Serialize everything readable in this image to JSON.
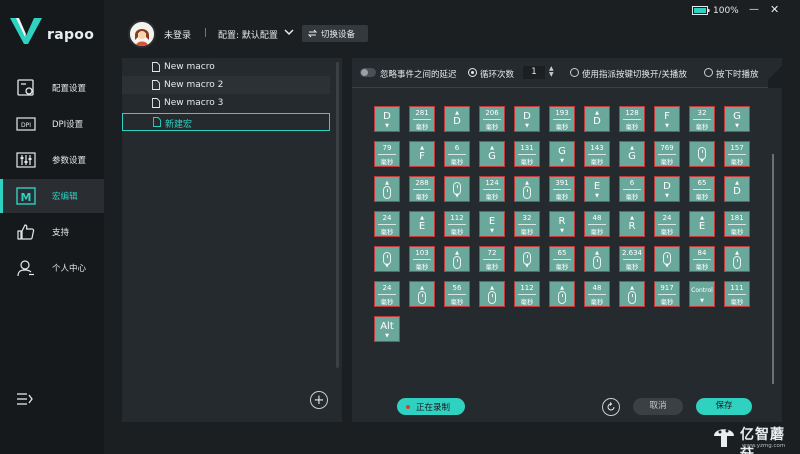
{
  "brand": {
    "name": "rapoo",
    "accent": "#2fd1c1"
  },
  "sidebar": {
    "items": [
      {
        "label": "配置设置",
        "icon": "config-icon"
      },
      {
        "label": "DPI设置",
        "icon": "dpi-icon"
      },
      {
        "label": "参数设置",
        "icon": "sliders-icon"
      },
      {
        "label": "宏编辑",
        "icon": "macro-icon",
        "active": true
      },
      {
        "label": "支持",
        "icon": "thumbs-up-icon"
      },
      {
        "label": "个人中心",
        "icon": "user-icon"
      }
    ],
    "dpi_icon_text": "DPI",
    "macro_icon_text": "M"
  },
  "topbar": {
    "login": "未登录",
    "separator": "|",
    "config": "配置: 默认配置",
    "switch_device": "切换设备",
    "battery": "100%",
    "minimize": "—",
    "close": "✕"
  },
  "macros": {
    "items": [
      "New macro",
      "New macro 2",
      "New macro 3",
      "新建宏"
    ],
    "selected_index": 3,
    "add_label": "+"
  },
  "editor": {
    "ignore_delay_label": "忽略事件之间的延迟",
    "loop_label": "循环次数",
    "loop_count": "1",
    "toggle_mode_label": "使用指派按键切换开/关播放",
    "hold_mode_label": "按下时播放",
    "stepper_up": "▲",
    "stepper_down": "▼",
    "delay_unit": "毫秒",
    "arrow_up": "▲",
    "arrow_down": "▼",
    "record_label": "正在录制",
    "cancel_label": "取消",
    "save_label": "保存",
    "events": [
      {
        "t": "key",
        "label": "D",
        "dir": "down"
      },
      {
        "t": "delay",
        "v": "281"
      },
      {
        "t": "key",
        "label": "D",
        "dir": "up"
      },
      {
        "t": "delay",
        "v": "206"
      },
      {
        "t": "key",
        "label": "D",
        "dir": "down"
      },
      {
        "t": "delay",
        "v": "193"
      },
      {
        "t": "key",
        "label": "D",
        "dir": "up"
      },
      {
        "t": "delay",
        "v": "128"
      },
      {
        "t": "key",
        "label": "F",
        "dir": "down"
      },
      {
        "t": "delay",
        "v": "32"
      },
      {
        "t": "key",
        "label": "G",
        "dir": "down"
      },
      {
        "t": "delay",
        "v": "79"
      },
      {
        "t": "key",
        "label": "F",
        "dir": "up"
      },
      {
        "t": "delay",
        "v": "6"
      },
      {
        "t": "key",
        "label": "G",
        "dir": "up"
      },
      {
        "t": "delay",
        "v": "131"
      },
      {
        "t": "key",
        "label": "G",
        "dir": "down"
      },
      {
        "t": "delay",
        "v": "143"
      },
      {
        "t": "key",
        "label": "G",
        "dir": "up"
      },
      {
        "t": "delay",
        "v": "769"
      },
      {
        "t": "mouse",
        "dir": "down"
      },
      {
        "t": "delay",
        "v": "157"
      },
      {
        "t": "mouse",
        "dir": "up"
      },
      {
        "t": "delay",
        "v": "288"
      },
      {
        "t": "mouse",
        "dir": "down"
      },
      {
        "t": "delay",
        "v": "124"
      },
      {
        "t": "mouse",
        "dir": "up"
      },
      {
        "t": "delay",
        "v": "391"
      },
      {
        "t": "key",
        "label": "E",
        "dir": "down"
      },
      {
        "t": "delay",
        "v": "6"
      },
      {
        "t": "key",
        "label": "D",
        "dir": "down"
      },
      {
        "t": "delay",
        "v": "65"
      },
      {
        "t": "key",
        "label": "D",
        "dir": "up"
      },
      {
        "t": "delay",
        "v": "24"
      },
      {
        "t": "key",
        "label": "E",
        "dir": "up"
      },
      {
        "t": "delay",
        "v": "112"
      },
      {
        "t": "key",
        "label": "E",
        "dir": "down"
      },
      {
        "t": "delay",
        "v": "32"
      },
      {
        "t": "key",
        "label": "R",
        "dir": "down"
      },
      {
        "t": "delay",
        "v": "48"
      },
      {
        "t": "key",
        "label": "R",
        "dir": "up"
      },
      {
        "t": "delay",
        "v": "24"
      },
      {
        "t": "key",
        "label": "E",
        "dir": "up"
      },
      {
        "t": "delay",
        "v": "181"
      },
      {
        "t": "mouse",
        "dir": "down"
      },
      {
        "t": "delay",
        "v": "103"
      },
      {
        "t": "mouse",
        "dir": "up"
      },
      {
        "t": "delay",
        "v": "72"
      },
      {
        "t": "mouse",
        "dir": "down"
      },
      {
        "t": "delay",
        "v": "65"
      },
      {
        "t": "mouse",
        "dir": "up"
      },
      {
        "t": "delay",
        "v": "2.634"
      },
      {
        "t": "mouse",
        "dir": "down"
      },
      {
        "t": "delay",
        "v": "84"
      },
      {
        "t": "mouse",
        "dir": "up"
      },
      {
        "t": "delay",
        "v": "24"
      },
      {
        "t": "mouse",
        "dir": "up"
      },
      {
        "t": "delay",
        "v": "56"
      },
      {
        "t": "mouse",
        "dir": "up"
      },
      {
        "t": "delay",
        "v": "112"
      },
      {
        "t": "mouse",
        "dir": "up"
      },
      {
        "t": "delay",
        "v": "48"
      },
      {
        "t": "mouse",
        "dir": "up"
      },
      {
        "t": "delay",
        "v": "917"
      },
      {
        "t": "key",
        "label": "Control",
        "dir": "down",
        "small": true
      },
      {
        "t": "delay",
        "v": "111"
      },
      {
        "t": "key",
        "label": "Alt",
        "dir": "down"
      }
    ]
  },
  "watermark": {
    "text": "亿智蘑菇",
    "sub": "www.yzmg.com"
  }
}
